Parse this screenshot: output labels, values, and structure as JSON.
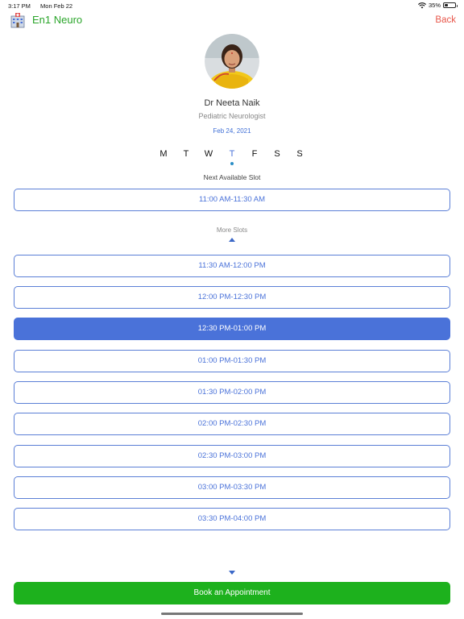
{
  "status_bar": {
    "time": "3:17 PM",
    "date": "Mon Feb 22",
    "battery_percent": "35%",
    "battery_level": 0.35
  },
  "nav": {
    "app_title": "En1 Neuro",
    "back_label": "Back",
    "app_icon": "hospital-building-icon"
  },
  "doctor": {
    "name": "Dr Neeta Naik",
    "specialty": "Pediatric Neurologist",
    "date": "Feb 24, 2021"
  },
  "weekdays": [
    {
      "label": "M",
      "active": false
    },
    {
      "label": "T",
      "active": false
    },
    {
      "label": "W",
      "active": false
    },
    {
      "label": "T",
      "active": true
    },
    {
      "label": "F",
      "active": false
    },
    {
      "label": "S",
      "active": false
    },
    {
      "label": "S",
      "active": false
    }
  ],
  "next_slot": {
    "label": "Next Available Slot",
    "value": "11:00 AM-11:30 AM"
  },
  "more_slots_label": "More Slots",
  "slots": [
    {
      "label": "11:30 AM-12:00 PM",
      "selected": false
    },
    {
      "label": "12:00 PM-12:30 PM",
      "selected": false
    },
    {
      "label": "12:30 PM-01:00 PM",
      "selected": true
    },
    {
      "label": "01:00 PM-01:30 PM",
      "selected": false
    },
    {
      "label": "01:30 PM-02:00 PM",
      "selected": false
    },
    {
      "label": "02:00 PM-02:30 PM",
      "selected": false
    },
    {
      "label": "02:30 PM-03:00 PM",
      "selected": false
    },
    {
      "label": "03:00 PM-03:30 PM",
      "selected": false
    },
    {
      "label": "03:30 PM-04:00 PM",
      "selected": false
    }
  ],
  "book_button_label": "Book an Appointment",
  "colors": {
    "accent": "#4a72d9",
    "brand_green": "#2aa52a",
    "book_green": "#1db11d",
    "back_red": "#e8564a"
  }
}
